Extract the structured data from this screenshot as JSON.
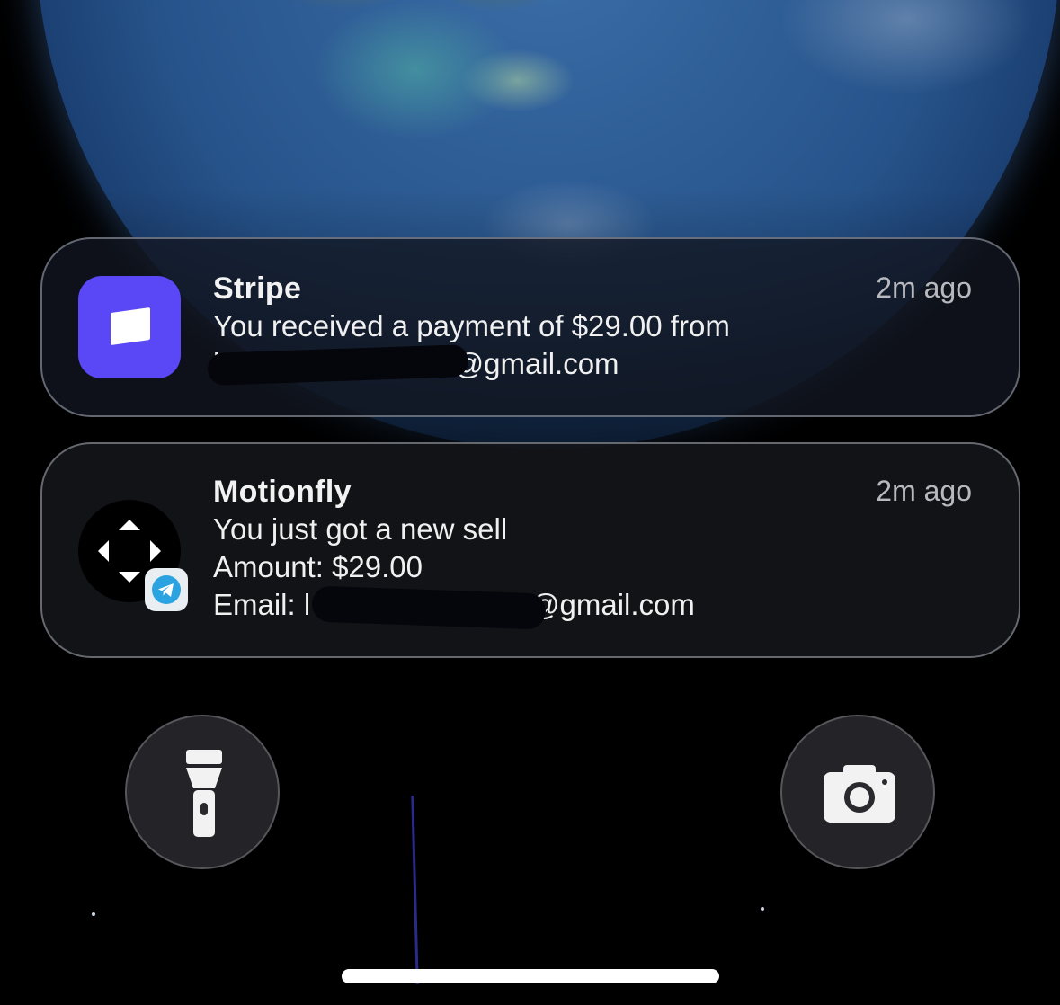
{
  "lock_screen": {
    "wallpaper": "earth-from-space",
    "notifications": [
      {
        "app_name": "Stripe",
        "time": "2m ago",
        "lines": [
          "You received a payment of $29.00 from",
          "l              ro@gmail.com"
        ],
        "icon": "stripe-logo-icon",
        "icon_color": "#5a47f5"
      },
      {
        "app_name": "Motionfly",
        "time": "2m ago",
        "lines": [
          "You just got a new sell",
          "Amount: $29.00",
          "Email: l             ro@gmail.com"
        ],
        "icon": "motionfly-logo-icon",
        "badge_icon": "telegram-icon",
        "badge_color": "#2aa3e0"
      }
    ],
    "quick_actions": {
      "left": "flashlight-icon",
      "right": "camera-icon"
    }
  }
}
